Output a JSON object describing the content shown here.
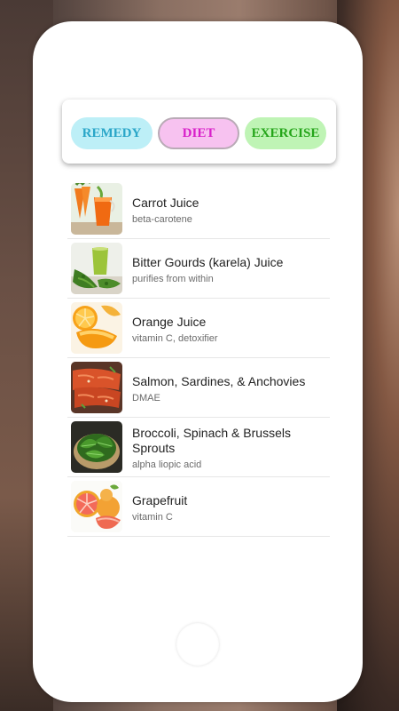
{
  "tabs": [
    {
      "label": "REMEDY"
    },
    {
      "label": "DIET"
    },
    {
      "label": "EXERCISE"
    }
  ],
  "items": [
    {
      "title": "Carrot Juice",
      "subtitle": "beta-carotene",
      "image": "carrot-juice-image"
    },
    {
      "title": "Bitter Gourds (karela) Juice",
      "subtitle": "purifies from within",
      "image": "bitter-gourd-juice-image"
    },
    {
      "title": "Orange Juice",
      "subtitle": "vitamin C, detoxifier",
      "image": "orange-slices-image"
    },
    {
      "title": "Salmon, Sardines, & Anchovies",
      "subtitle": "DMAE",
      "image": "salmon-fillet-image"
    },
    {
      "title": "Broccoli, Spinach & Brussels Sprouts",
      "subtitle": "alpha liopic acid",
      "image": "spinach-bowl-image"
    },
    {
      "title": "Grapefruit",
      "subtitle": "vitamin C",
      "image": "grapefruit-image"
    }
  ],
  "colors": {
    "remedy_bg": "#bdeff7",
    "remedy_text": "#2aa6c8",
    "diet_bg": "#f7c2f0",
    "diet_text": "#d81fc9",
    "exercise_bg": "#bff4b5",
    "exercise_text": "#25a51a"
  }
}
